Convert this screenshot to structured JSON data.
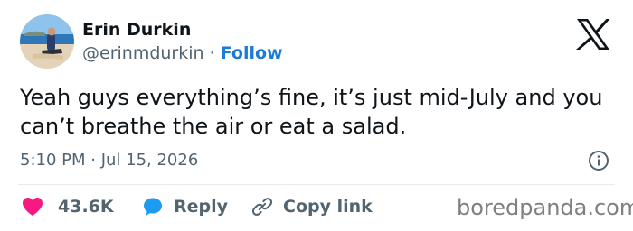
{
  "author": {
    "display_name": "Erin Durkin",
    "handle": "@erinmdurkin",
    "separator": "·",
    "follow_label": "Follow"
  },
  "tweet": {
    "text": "Yeah guys everything’s fine, it’s just mid-July and you can’t breathe the air or eat a salad.",
    "timestamp": "5:10 PM · Jul 15, 2026"
  },
  "actions": {
    "like_count": "43.6K",
    "reply_label": "Reply",
    "copy_link_label": "Copy link"
  },
  "watermark": "boredpanda.com",
  "icons": {
    "x": "x-logo-icon",
    "info": "info-icon",
    "like": "heart-icon",
    "reply": "speech-bubble-icon",
    "copy": "link-icon"
  },
  "colors": {
    "text": "#0f1419",
    "muted": "#536471",
    "link": "#1d7bd8",
    "like": "#f91880",
    "reply": "#1d9bf0",
    "divider": "#e6eaed",
    "watermark": "#7f7f7f"
  }
}
